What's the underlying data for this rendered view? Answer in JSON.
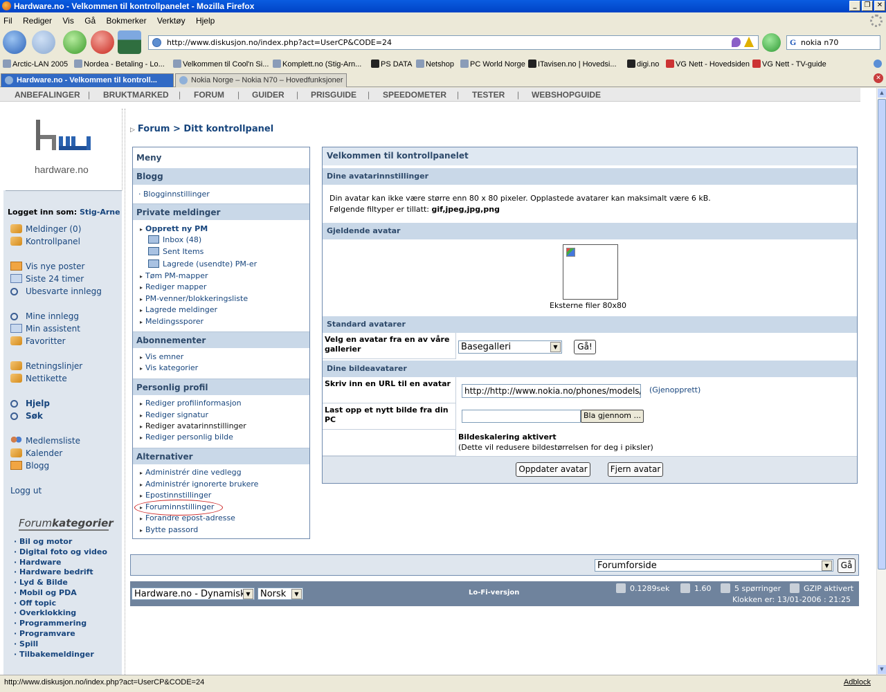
{
  "window": {
    "title": "Hardware.no - Velkommen til kontrollpanelet - Mozilla Firefox",
    "menu": [
      "Fil",
      "Rediger",
      "Vis",
      "Gå",
      "Bokmerker",
      "Verktøy",
      "Hjelp"
    ]
  },
  "browser": {
    "url": "http://www.diskusjon.no/index.php?act=UserCP&CODE=24",
    "search_value": "nokia n70",
    "bookmarks": [
      "Arctic-LAN 2005",
      "Nordea - Betaling - Lo...",
      "Velkommen til Cool'n Si...",
      "Komplett.no (Stig-Arn...",
      "PS DATA",
      "Netshop",
      "PC World Norge",
      "ITavisen.no | Hovedsi...",
      "digi.no",
      "VG Nett - Hovedsiden",
      "VG Nett - TV-guide"
    ],
    "tabs": [
      {
        "label": "Hardware.no - Velkommen til kontroll...",
        "active": true
      },
      {
        "label": "Nokia Norge – Nokia N70 – Hovedfunksjoner",
        "active": false
      }
    ],
    "status_text": "http://www.diskusjon.no/index.php?act=UserCP&CODE=24",
    "adblock": "Adblock"
  },
  "topnav": [
    "ANBEFALINGER",
    "BRUKTMARKED",
    "FORUM",
    "GUIDER",
    "PRISGUIDE",
    "SPEEDOMETER",
    "TESTER",
    "WEBSHOPGUIDE"
  ],
  "sidebar": {
    "logo_text": "hardware.no",
    "logged_in_label": "Logget inn som:",
    "username": "Stig-Arne",
    "links": [
      {
        "label": "Meldinger (0)",
        "icon": "pen-icon"
      },
      {
        "label": "Kontrollpanel",
        "icon": "pen-icon"
      },
      {
        "label": "Vis nye poster",
        "icon": "mail-icon"
      },
      {
        "label": "Siste 24 timer",
        "icon": "calendar-icon"
      },
      {
        "label": "Ubesvarte innlegg",
        "icon": "search-icon"
      },
      {
        "label": "Mine innlegg",
        "icon": "search-icon"
      },
      {
        "label": "Min assistent",
        "icon": "calendar-icon"
      },
      {
        "label": "Favoritter",
        "icon": "pen-icon"
      },
      {
        "label": "Retningslinjer",
        "icon": "pen-icon"
      },
      {
        "label": "Nettikette",
        "icon": "pen-icon"
      },
      {
        "label": "Hjelp",
        "icon": "search-icon"
      },
      {
        "label": "Søk",
        "icon": "search-icon"
      },
      {
        "label": "Medlemsliste",
        "icon": "members-icon"
      },
      {
        "label": "Kalender",
        "icon": "pen-icon"
      },
      {
        "label": "Blogg",
        "icon": "mail-icon"
      },
      {
        "label": "Logg ut",
        "icon": ""
      }
    ],
    "categories_title_a": "Forum",
    "categories_title_b": "kategorier",
    "categories": [
      "Bil og motor",
      "Digital foto og video",
      "Hardware",
      "Hardware bedrift",
      "Lyd & Bilde",
      "Mobil og PDA",
      "Off topic",
      "Overklokking",
      "Programmering",
      "Programvare",
      "Spill",
      "Tilbakemeldinger"
    ]
  },
  "breadcrumb": {
    "forum": "Forum",
    "sep": ">",
    "current": "Ditt kontrollpanel"
  },
  "menu": {
    "title": "Meny",
    "sections": {
      "blogg": {
        "title": "Blogg",
        "items": [
          "Blogginnstillinger"
        ]
      },
      "pm": {
        "title": "Private meldinger",
        "new": "Opprett ny PM",
        "folders": [
          "Inbox (48)",
          "Sent Items",
          "Lagrede (usendte) PM-er"
        ],
        "items": [
          "Tøm PM-mapper",
          "Rediger mapper",
          "PM-venner/blokkeringsliste",
          "Lagrede meldinger",
          "Meldingssporer"
        ]
      },
      "abo": {
        "title": "Abonnementer",
        "items": [
          "Vis emner",
          "Vis kategorier"
        ]
      },
      "profil": {
        "title": "Personlig profil",
        "items": [
          "Rediger profilinformasjon",
          "Rediger signatur",
          "Rediger avatarinnstillinger",
          "Rediger personlig bilde"
        ]
      },
      "alt": {
        "title": "Alternativer",
        "items": [
          "Administrér dine vedlegg",
          "Administrér ignorerte brukere",
          "Epostinnstillinger",
          "Foruminnstillinger",
          "Forandre epost-adresse",
          "Bytte passord"
        ]
      }
    }
  },
  "panel": {
    "title": "Velkommen til kontrollpanelet",
    "avatar_settings_head": "Dine avatarinnstillinger",
    "avatar_rule_1": "Din avatar kan ikke være større enn 80 x 80 pixeler. Opplastede avatarer kan maksimalt være 6 kB.",
    "avatar_rule_2_prefix": "Følgende filtyper er tillatt:",
    "avatar_rule_2_types": "gif,jpeg,jpg,png",
    "current_avatar_head": "Gjeldende avatar",
    "current_avatar_caption": "Eksterne filer 80x80",
    "standard_head": "Standard avatarer",
    "gallery_label": "Velg en avatar fra en av våre gallerier",
    "gallery_value": "Basegalleri",
    "go_label": "Gå!",
    "image_avatars_head": "Dine bildeavatarer",
    "url_label": "Skriv inn en URL til en avatar",
    "url_value": "http://http://www.nokia.no/phones/models/",
    "restore_label": "(Gjenopprett)",
    "upload_label": "Last opp et nytt bilde fra din PC",
    "browse_label": "Bla gjennom ...",
    "scaling_title": "Bildeskalering aktivert",
    "scaling_note": "(Dette vil redusere bildestørrelsen for deg i piksler)",
    "update_button": "Oppdater avatar",
    "remove_button": "Fjern avatar"
  },
  "footer": {
    "jump_value": "Forumforside",
    "jump_go": "Gå",
    "skin_value": "Hardware.no - Dynamisk",
    "lang_value": "Norsk",
    "lofi": "Lo-Fi-versjon",
    "time_sec": "0.1289sek",
    "load": "1.60",
    "queries": "5 spørringer",
    "gzip": "GZIP aktivert",
    "clock": "Klokken er: 13/01-2006 : 21:25"
  }
}
